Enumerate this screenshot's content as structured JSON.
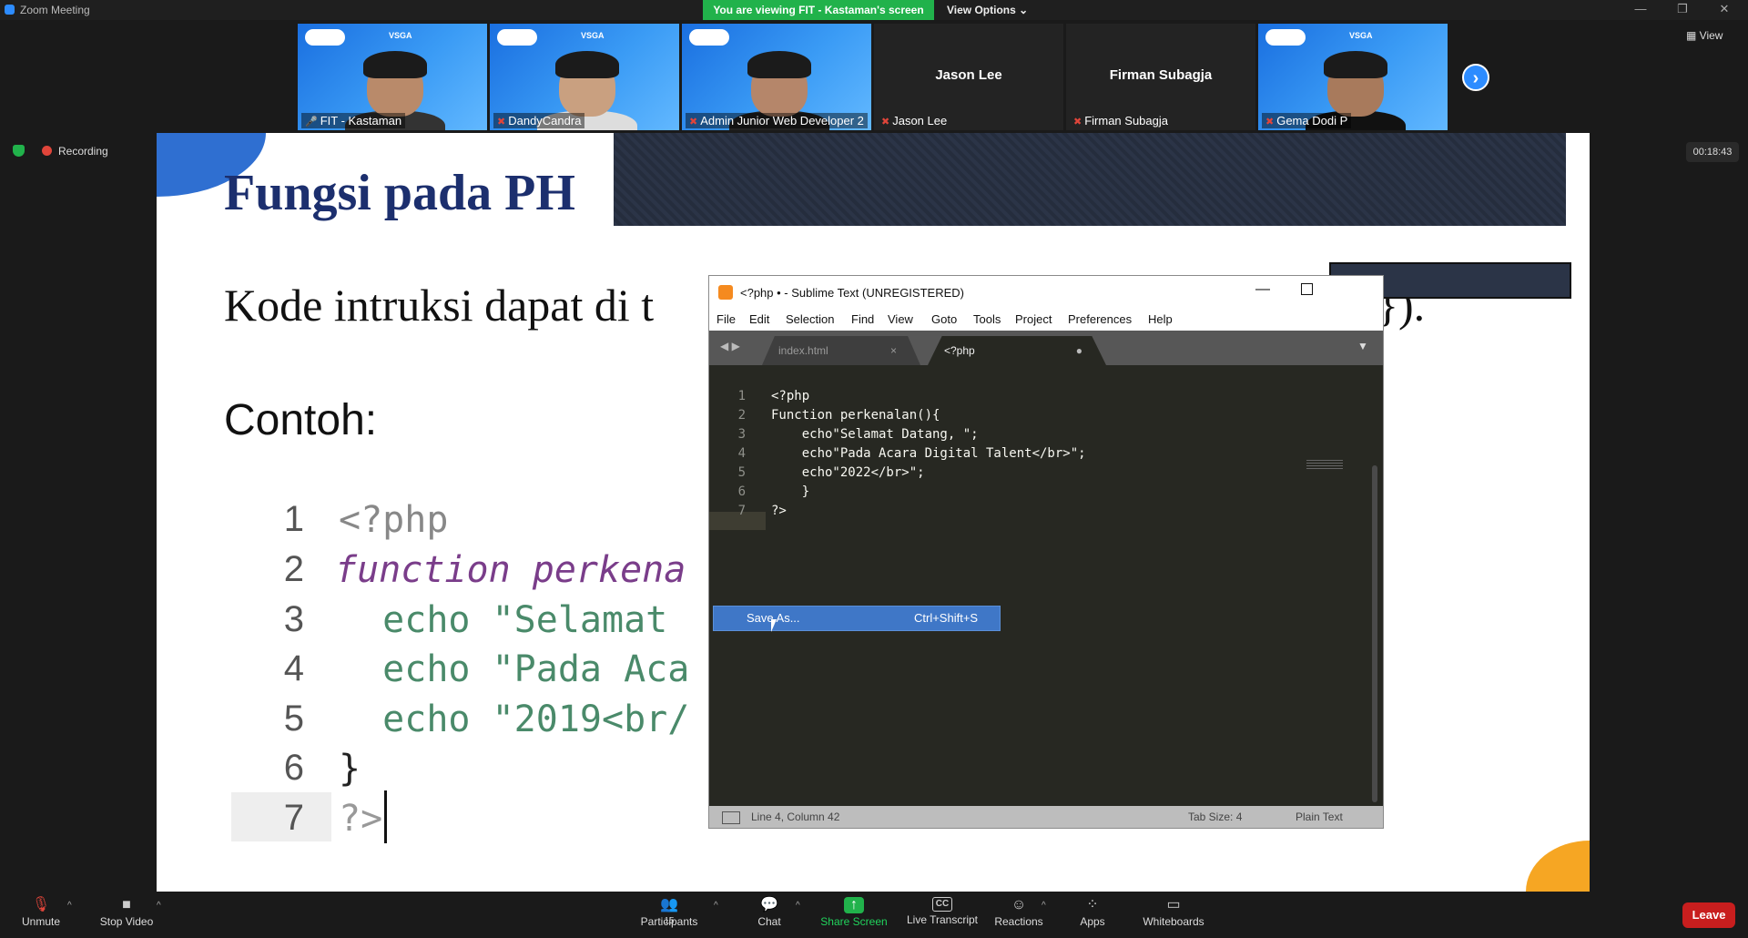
{
  "window": {
    "title": "Zoom Meeting",
    "viewing_banner": "You are viewing FIT - Kastaman's screen",
    "view_options": "View Options ⌄",
    "minimize": "—",
    "restore": "❐",
    "close": "✕"
  },
  "gallery": {
    "tiles": [
      {
        "label": "FIT - Kastaman",
        "video": true
      },
      {
        "label": "DandyCandra",
        "video": true
      },
      {
        "label": "Admin Junior Web Developer 2",
        "video": true
      },
      {
        "label": "Jason Lee",
        "video": false,
        "name": "Jason Lee"
      },
      {
        "label": "Firman Subagja",
        "video": false,
        "name": "Firman Subagja"
      },
      {
        "label": "Gema Dodi P",
        "video": true
      }
    ],
    "vsga": "VSGA",
    "next_arrow": "›",
    "view_label": "View"
  },
  "recording": {
    "label": "Recording",
    "timer": "00:18:43"
  },
  "slide": {
    "title": "Fungsi pada PH",
    "text": "Kode intruksi dapat di t",
    "text_end": "}).",
    "contoh": "Contoh:",
    "code": [
      {
        "ln": "1",
        "text": "<?php"
      },
      {
        "ln": "2",
        "text": "function perkena"
      },
      {
        "ln": "3",
        "text": "  echo \"Selamat "
      },
      {
        "ln": "4",
        "text": "  echo \"Pada Aca"
      },
      {
        "ln": "5",
        "text": "  echo \"2019<br/"
      },
      {
        "ln": "6",
        "text": "}"
      },
      {
        "ln": "7",
        "text": "?>"
      }
    ]
  },
  "sublime": {
    "title": "<?php • - Sublime Text (UNREGISTERED)",
    "menu": [
      "File",
      "Edit",
      "Selection",
      "Find",
      "View",
      "Goto",
      "Tools",
      "Project",
      "Preferences",
      "Help"
    ],
    "tabs": [
      {
        "label": "index.html",
        "close": "×"
      },
      {
        "label": "<?php",
        "close": "●"
      }
    ],
    "code": [
      {
        "ln": "1",
        "text": "<?php"
      },
      {
        "ln": "2",
        "text": "Function perkenalan(){"
      },
      {
        "ln": "3",
        "text": "    echo\"Selamat Datang, \";"
      },
      {
        "ln": "4",
        "text": "    echo\"Pada Acara Digital Talent</br>\";"
      },
      {
        "ln": "5",
        "text": "    echo\"2022</br>\";"
      },
      {
        "ln": "6",
        "text": "    }"
      },
      {
        "ln": "7",
        "text": "?>"
      }
    ],
    "context_menu": {
      "label": "Save As...",
      "shortcut": "Ctrl+Shift+S"
    },
    "status": {
      "position": "Line 4, Column 42",
      "tab_size": "Tab Size: 4",
      "syntax": "Plain Text"
    }
  },
  "toolbar": {
    "unmute": "Unmute",
    "stop_video": "Stop Video",
    "participants": "Participants",
    "participants_count": "15",
    "chat": "Chat",
    "share_screen": "Share Screen",
    "live_transcript": "Live Transcript",
    "reactions": "Reactions",
    "apps": "Apps",
    "whiteboards": "Whiteboards",
    "leave": "Leave",
    "cc": "CC",
    "caret": "^"
  },
  "colors": {
    "accent": "#2d8cff",
    "banner": "#21b24b",
    "leave": "#c81e1e"
  }
}
